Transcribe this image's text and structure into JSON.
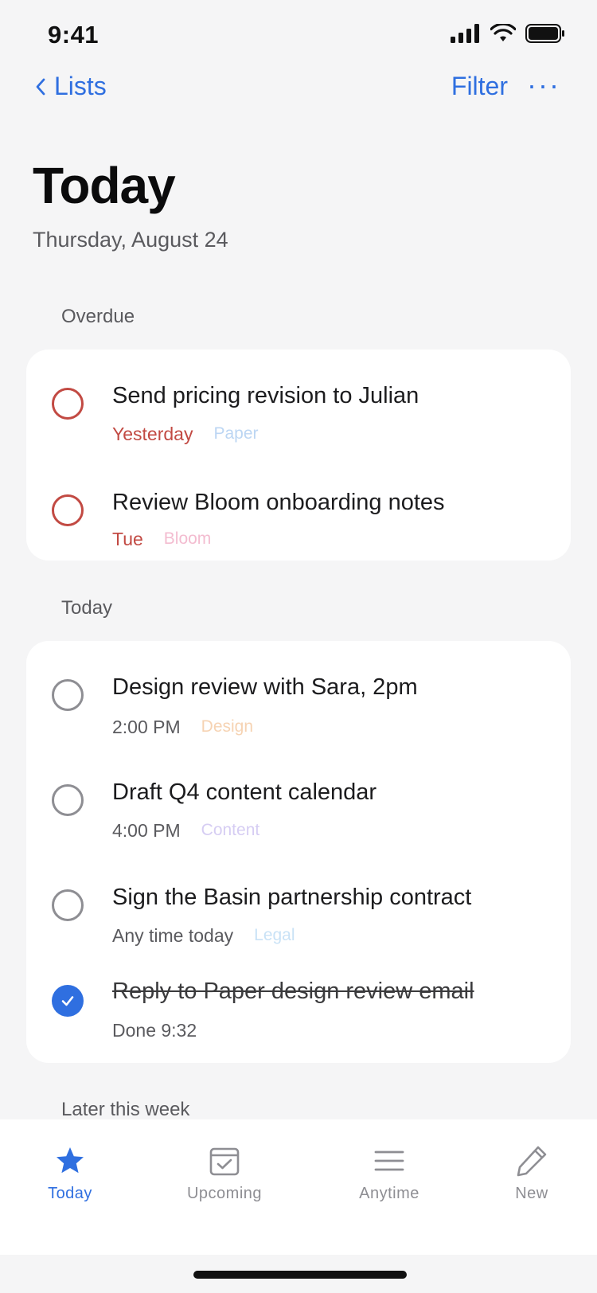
{
  "status_bar": {
    "time": "9:41"
  },
  "nav": {
    "back_label": "Lists",
    "filter_label": "Filter",
    "more_label": "···"
  },
  "header": {
    "title": "Today",
    "date": "Thursday, August 24"
  },
  "sections": {
    "overdue": {
      "label": "Overdue",
      "tasks": [
        {
          "title": "Send pricing revision to Julian",
          "when": "Yesterday",
          "tag": "Paper"
        },
        {
          "title": "Review Bloom onboarding notes",
          "when": "Tue",
          "tag": "Bloom"
        }
      ]
    },
    "today": {
      "label": "Today",
      "tasks": [
        {
          "title": "Design review with Sara, 2pm",
          "when": "2:00 PM",
          "tag": "Design"
        },
        {
          "title": "Draft Q4 content calendar",
          "when": "4:00 PM",
          "tag": "Content"
        },
        {
          "title": "Sign the Basin partnership contract",
          "when": "Any time today",
          "tag": "Legal"
        },
        {
          "title": "Reply to Paper design review email",
          "when": "Done 9:32",
          "done": true
        }
      ]
    },
    "later": {
      "label": "Later this week"
    }
  },
  "tabbar": {
    "tabs": [
      {
        "label": "Today",
        "icon": "star-icon",
        "active": true
      },
      {
        "label": "Upcoming",
        "icon": "calendar-check-icon"
      },
      {
        "label": "Anytime",
        "icon": "list-icon"
      },
      {
        "label": "New",
        "icon": "pencil-icon"
      }
    ]
  },
  "colors": {
    "accent": "#2f6fe0",
    "overdue": "#c24a43",
    "tag_paper": "#bcd6f3",
    "tag_bloom": "#f3bcd0",
    "tag_design": "#f6d3b3",
    "tag_content": "#d6cdf3",
    "tag_legal": "#c9e2f6"
  }
}
